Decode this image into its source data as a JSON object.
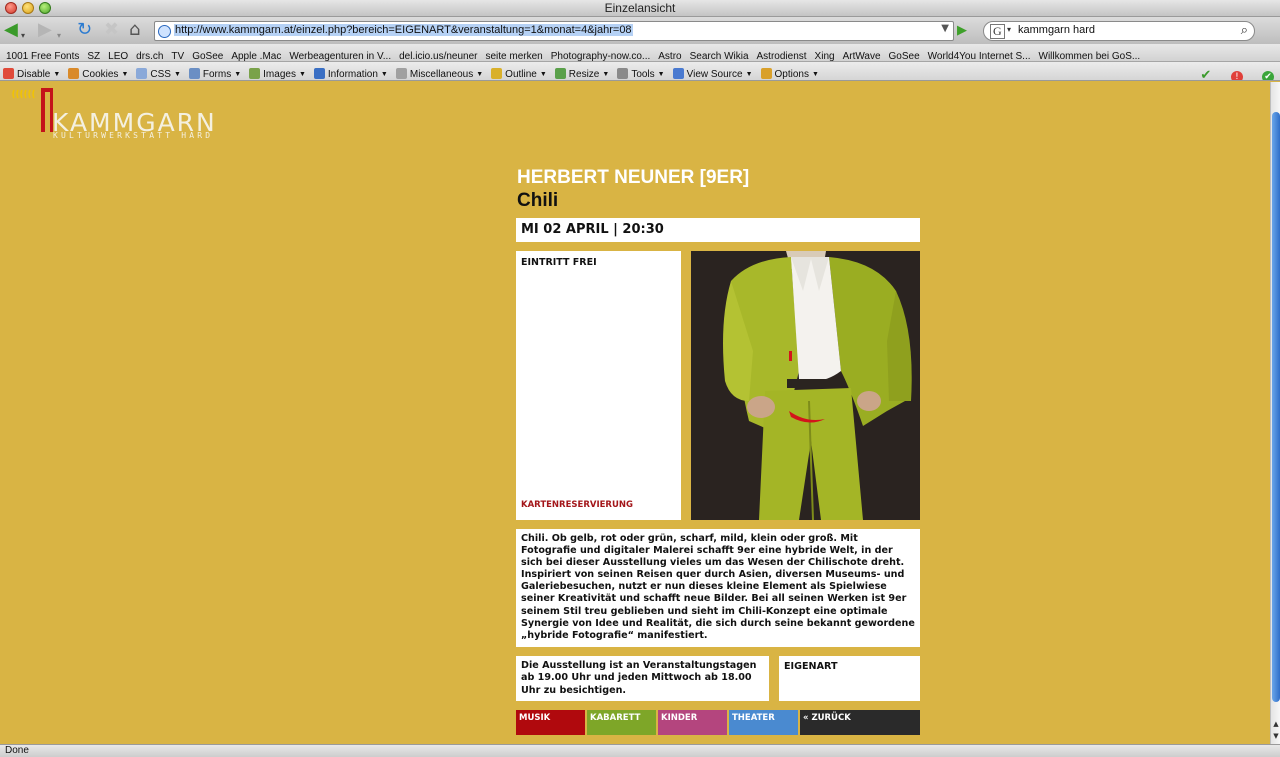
{
  "window": {
    "title": "Einzelansicht"
  },
  "nav": {
    "url": "http://www.kammgarn.at/einzel.php?bereich=EIGENART&veranstaltung=1&monat=4&jahr=08",
    "search_value": "kammgarn hard",
    "search_engine_label": "G"
  },
  "bookmarks": [
    "1001 Free Fonts",
    "SZ",
    "LEO",
    "drs.ch",
    "TV",
    "GoSee",
    "Apple .Mac",
    "Werbeagenturen in V...",
    "del.icio.us/neuner",
    "seite merken",
    "Photography-now.co...",
    "Astro",
    "Search Wikia",
    "Astrodienst",
    "Xing",
    "ArtWave",
    "GoSee",
    "World4You Internet S...",
    "Willkommen bei GoS..."
  ],
  "devtoolbar": [
    {
      "label": "Disable",
      "icon": "disable-icon",
      "color": "#e04a3a"
    },
    {
      "label": "Cookies",
      "icon": "cookie-icon",
      "color": "#d98a2a"
    },
    {
      "label": "CSS",
      "icon": "css-icon",
      "color": "#8aa9d9"
    },
    {
      "label": "Forms",
      "icon": "form-icon",
      "color": "#6b8fc4"
    },
    {
      "label": "Images",
      "icon": "image-icon",
      "color": "#7aa24a"
    },
    {
      "label": "Information",
      "icon": "info-icon",
      "color": "#3a6fc4"
    },
    {
      "label": "Miscellaneous",
      "icon": "misc-icon",
      "color": "#a0a0a0"
    },
    {
      "label": "Outline",
      "icon": "pencil-icon",
      "color": "#d9b02a"
    },
    {
      "label": "Resize",
      "icon": "resize-icon",
      "color": "#5aa04a"
    },
    {
      "label": "Tools",
      "icon": "wrench-icon",
      "color": "#8a8a8a"
    },
    {
      "label": "View Source",
      "icon": "source-icon",
      "color": "#4a7ad0"
    },
    {
      "label": "Options",
      "icon": "options-icon",
      "color": "#d9a02a"
    }
  ],
  "logo": {
    "word": "KAMMGARN",
    "subtitle": "KULTURWERKSTATT HARD"
  },
  "event": {
    "artist": "HERBERT NEUNER [9ER]",
    "title": "Chili",
    "datetime": "MI 02 APRIL | 20:30",
    "entry": "EINTRITT FREI",
    "reservation_label": "KARTENRESERVIERUNG",
    "description": "Chili. Ob gelb, rot oder grün, scharf, mild, klein oder groß. Mit Fotografie und digitaler Malerei schafft 9er eine hybride Welt, in der sich bei dieser Ausstellung vieles um das Wesen der Chilischote dreht. Inspiriert von seinen Reisen quer durch Asien, diversen Museums- und Galeriebesuchen, nutzt er nun dieses kleine Element als Spielwiese seiner Kreativität und schafft neue Bilder. Bei all seinen Werken ist 9er seinem Stil treu geblieben und sieht im Chili-Konzept eine optimale Synergie von Idee und Realität, die sich durch seine bekannt gewordene „hybride Fotografie“ manifestiert.",
    "hours": "Die Ausstellung ist an Veranstaltungstagen ab 19.00 Uhr und jeden Mittwoch ab 18.00 Uhr zu besichtigen.",
    "category": "EIGENART"
  },
  "menu": [
    {
      "label": "MUSIK",
      "color": "#b0090d"
    },
    {
      "label": "KABARETT",
      "color": "#7ea628"
    },
    {
      "label": "KINDER",
      "color": "#b4457e"
    },
    {
      "label": "THEATER",
      "color": "#4a8ad0"
    },
    {
      "label": "« ZURÜCK",
      "color": "#2a2a2a"
    }
  ],
  "status": {
    "text": "Done"
  }
}
